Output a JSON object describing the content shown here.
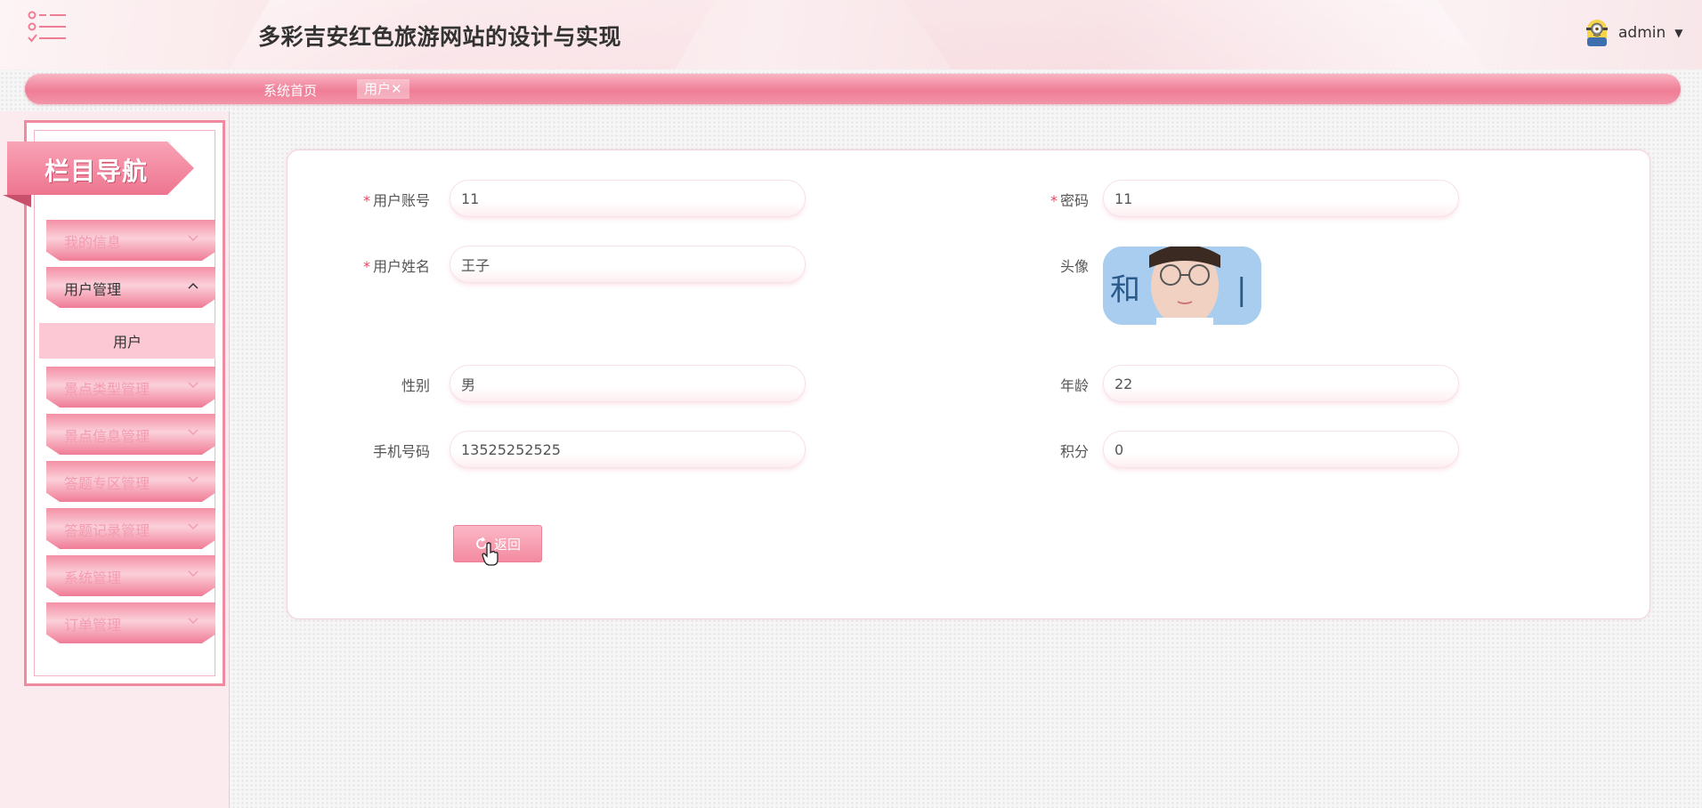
{
  "header": {
    "title": "多彩吉安红色旅游网站的设计与实现",
    "user": "admin"
  },
  "breadcrumb": {
    "home": "系统首页",
    "current_tab": "用户",
    "close_glyph": "✕"
  },
  "sidebar": {
    "title": "栏目导航",
    "items": [
      {
        "label": "我的信息",
        "expanded": false
      },
      {
        "label": "用户管理",
        "expanded": true,
        "children": [
          "用户"
        ]
      },
      {
        "label": "景点类型管理",
        "expanded": false
      },
      {
        "label": "景点信息管理",
        "expanded": false
      },
      {
        "label": "答题专区管理",
        "expanded": false
      },
      {
        "label": "答题记录管理",
        "expanded": false
      },
      {
        "label": "系统管理",
        "expanded": false
      },
      {
        "label": "订单管理",
        "expanded": false
      }
    ]
  },
  "form": {
    "account": {
      "label": "用户账号",
      "value": "11",
      "required": true
    },
    "password": {
      "label": "密码",
      "value": "11",
      "required": true
    },
    "name": {
      "label": "用户姓名",
      "value": "王子",
      "required": true
    },
    "avatar": {
      "label": "头像",
      "image_text": "和"
    },
    "gender": {
      "label": "性别",
      "value": "男"
    },
    "age": {
      "label": "年龄",
      "value": "22"
    },
    "phone": {
      "label": "手机号码",
      "value": "13525252525"
    },
    "points": {
      "label": "积分",
      "value": "0"
    },
    "back_button": "返回",
    "required_mark": "*"
  },
  "colors": {
    "accent": "#ef7d96",
    "accent_light": "#fbc8d4",
    "required": "#e8455f"
  }
}
